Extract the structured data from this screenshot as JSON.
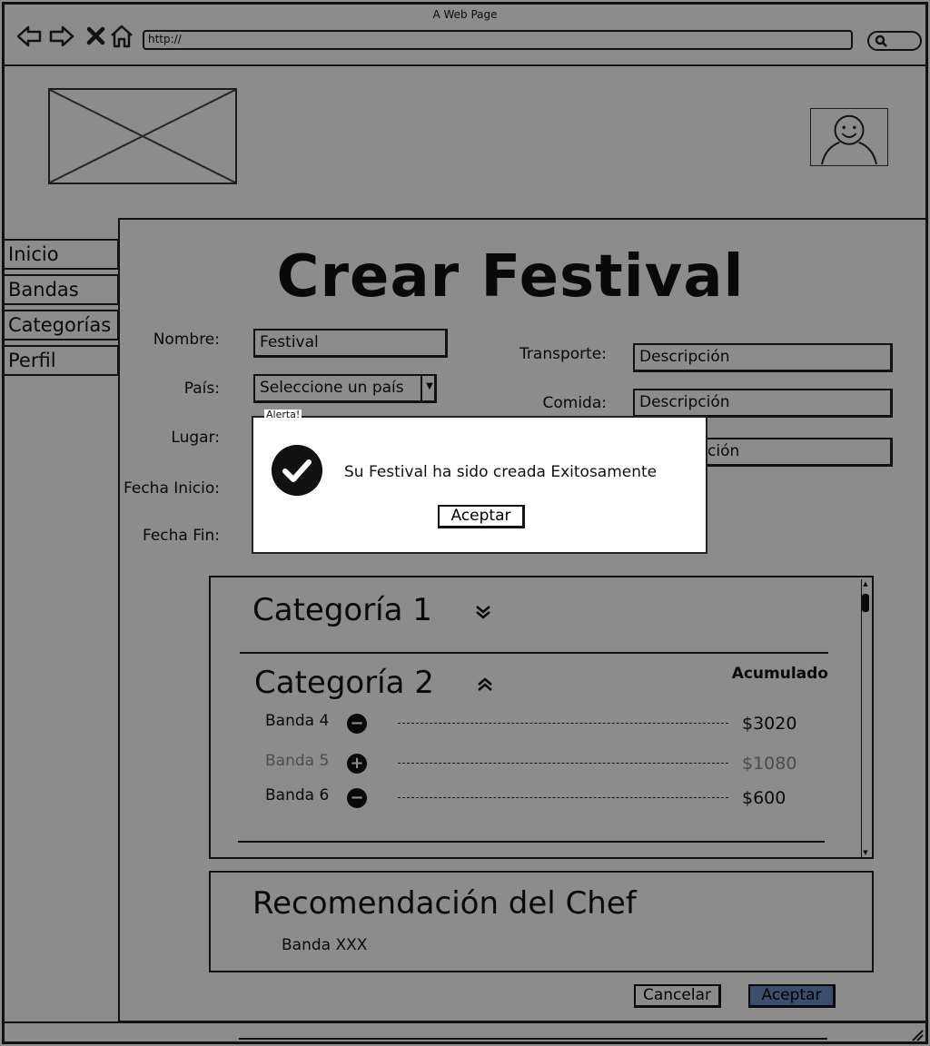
{
  "browser": {
    "title": "A Web Page",
    "url": "http://"
  },
  "sidebar": {
    "items": [
      {
        "label": "Inicio"
      },
      {
        "label": "Bandas"
      },
      {
        "label": "Categorías"
      },
      {
        "label": "Perfil"
      }
    ]
  },
  "page": {
    "title": "Crear Festival"
  },
  "form": {
    "left": {
      "nombre_label": "Nombre:",
      "nombre_value": "Festival",
      "pais_label": "País:",
      "pais_value": "Seleccione un país",
      "lugar_label": "Lugar:",
      "fecha_inicio_label": "Fecha Inicio:",
      "fecha_fin_label": "Fecha Fin:"
    },
    "right": {
      "transporte_label": "Transporte:",
      "transporte_value": "Descripción",
      "comida_label": "Comida:",
      "comida_value": "Descripción",
      "third_value_visible": "ción"
    }
  },
  "categories": {
    "cat1_title": "Categoría 1",
    "cat2_title": "Categoría 2",
    "accumulated_label": "Acumulado",
    "bands": [
      {
        "name": "Banda 4",
        "price": "$3020",
        "icon": "minus-circle-icon"
      },
      {
        "name": "Banda 5",
        "price": "$1080",
        "icon": "plus-circle-icon"
      },
      {
        "name": "Banda 6",
        "price": "$600",
        "icon": "minus-circle-icon"
      }
    ]
  },
  "chef": {
    "title": "Recomendación del Chef",
    "band": "Banda XXX"
  },
  "actions": {
    "cancel_label": "Cancelar",
    "accept_label": "Aceptar"
  },
  "alert": {
    "legend": "Alerta!",
    "message": "Su Festival ha sido creada Exitosamente",
    "button_label": "Aceptar",
    "icon": "check-circle-icon"
  },
  "colors": {
    "primary_button": "#6d8ec8",
    "overlay": "rgba(0,0,0,0.45)"
  }
}
